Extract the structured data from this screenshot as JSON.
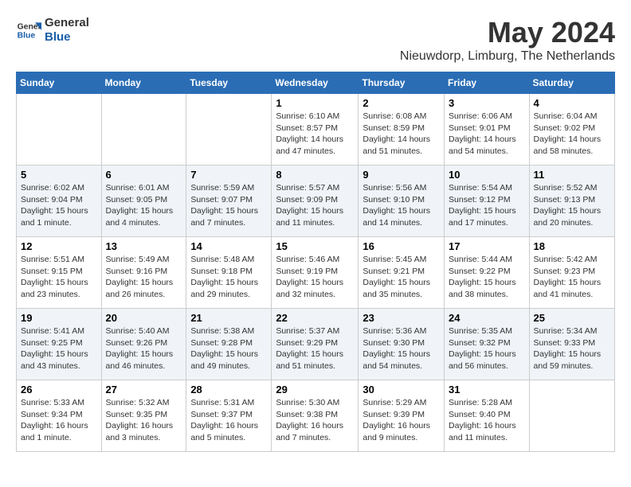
{
  "logo": {
    "general": "General",
    "blue": "Blue"
  },
  "title": "May 2024",
  "location": "Nieuwdorp, Limburg, The Netherlands",
  "days_header": [
    "Sunday",
    "Monday",
    "Tuesday",
    "Wednesday",
    "Thursday",
    "Friday",
    "Saturday"
  ],
  "weeks": [
    [
      {
        "day": "",
        "sunrise": "",
        "sunset": "",
        "daylight": ""
      },
      {
        "day": "",
        "sunrise": "",
        "sunset": "",
        "daylight": ""
      },
      {
        "day": "",
        "sunrise": "",
        "sunset": "",
        "daylight": ""
      },
      {
        "day": "1",
        "sunrise": "Sunrise: 6:10 AM",
        "sunset": "Sunset: 8:57 PM",
        "daylight": "Daylight: 14 hours and 47 minutes."
      },
      {
        "day": "2",
        "sunrise": "Sunrise: 6:08 AM",
        "sunset": "Sunset: 8:59 PM",
        "daylight": "Daylight: 14 hours and 51 minutes."
      },
      {
        "day": "3",
        "sunrise": "Sunrise: 6:06 AM",
        "sunset": "Sunset: 9:01 PM",
        "daylight": "Daylight: 14 hours and 54 minutes."
      },
      {
        "day": "4",
        "sunrise": "Sunrise: 6:04 AM",
        "sunset": "Sunset: 9:02 PM",
        "daylight": "Daylight: 14 hours and 58 minutes."
      }
    ],
    [
      {
        "day": "5",
        "sunrise": "Sunrise: 6:02 AM",
        "sunset": "Sunset: 9:04 PM",
        "daylight": "Daylight: 15 hours and 1 minute."
      },
      {
        "day": "6",
        "sunrise": "Sunrise: 6:01 AM",
        "sunset": "Sunset: 9:05 PM",
        "daylight": "Daylight: 15 hours and 4 minutes."
      },
      {
        "day": "7",
        "sunrise": "Sunrise: 5:59 AM",
        "sunset": "Sunset: 9:07 PM",
        "daylight": "Daylight: 15 hours and 7 minutes."
      },
      {
        "day": "8",
        "sunrise": "Sunrise: 5:57 AM",
        "sunset": "Sunset: 9:09 PM",
        "daylight": "Daylight: 15 hours and 11 minutes."
      },
      {
        "day": "9",
        "sunrise": "Sunrise: 5:56 AM",
        "sunset": "Sunset: 9:10 PM",
        "daylight": "Daylight: 15 hours and 14 minutes."
      },
      {
        "day": "10",
        "sunrise": "Sunrise: 5:54 AM",
        "sunset": "Sunset: 9:12 PM",
        "daylight": "Daylight: 15 hours and 17 minutes."
      },
      {
        "day": "11",
        "sunrise": "Sunrise: 5:52 AM",
        "sunset": "Sunset: 9:13 PM",
        "daylight": "Daylight: 15 hours and 20 minutes."
      }
    ],
    [
      {
        "day": "12",
        "sunrise": "Sunrise: 5:51 AM",
        "sunset": "Sunset: 9:15 PM",
        "daylight": "Daylight: 15 hours and 23 minutes."
      },
      {
        "day": "13",
        "sunrise": "Sunrise: 5:49 AM",
        "sunset": "Sunset: 9:16 PM",
        "daylight": "Daylight: 15 hours and 26 minutes."
      },
      {
        "day": "14",
        "sunrise": "Sunrise: 5:48 AM",
        "sunset": "Sunset: 9:18 PM",
        "daylight": "Daylight: 15 hours and 29 minutes."
      },
      {
        "day": "15",
        "sunrise": "Sunrise: 5:46 AM",
        "sunset": "Sunset: 9:19 PM",
        "daylight": "Daylight: 15 hours and 32 minutes."
      },
      {
        "day": "16",
        "sunrise": "Sunrise: 5:45 AM",
        "sunset": "Sunset: 9:21 PM",
        "daylight": "Daylight: 15 hours and 35 minutes."
      },
      {
        "day": "17",
        "sunrise": "Sunrise: 5:44 AM",
        "sunset": "Sunset: 9:22 PM",
        "daylight": "Daylight: 15 hours and 38 minutes."
      },
      {
        "day": "18",
        "sunrise": "Sunrise: 5:42 AM",
        "sunset": "Sunset: 9:23 PM",
        "daylight": "Daylight: 15 hours and 41 minutes."
      }
    ],
    [
      {
        "day": "19",
        "sunrise": "Sunrise: 5:41 AM",
        "sunset": "Sunset: 9:25 PM",
        "daylight": "Daylight: 15 hours and 43 minutes."
      },
      {
        "day": "20",
        "sunrise": "Sunrise: 5:40 AM",
        "sunset": "Sunset: 9:26 PM",
        "daylight": "Daylight: 15 hours and 46 minutes."
      },
      {
        "day": "21",
        "sunrise": "Sunrise: 5:38 AM",
        "sunset": "Sunset: 9:28 PM",
        "daylight": "Daylight: 15 hours and 49 minutes."
      },
      {
        "day": "22",
        "sunrise": "Sunrise: 5:37 AM",
        "sunset": "Sunset: 9:29 PM",
        "daylight": "Daylight: 15 hours and 51 minutes."
      },
      {
        "day": "23",
        "sunrise": "Sunrise: 5:36 AM",
        "sunset": "Sunset: 9:30 PM",
        "daylight": "Daylight: 15 hours and 54 minutes."
      },
      {
        "day": "24",
        "sunrise": "Sunrise: 5:35 AM",
        "sunset": "Sunset: 9:32 PM",
        "daylight": "Daylight: 15 hours and 56 minutes."
      },
      {
        "day": "25",
        "sunrise": "Sunrise: 5:34 AM",
        "sunset": "Sunset: 9:33 PM",
        "daylight": "Daylight: 15 hours and 59 minutes."
      }
    ],
    [
      {
        "day": "26",
        "sunrise": "Sunrise: 5:33 AM",
        "sunset": "Sunset: 9:34 PM",
        "daylight": "Daylight: 16 hours and 1 minute."
      },
      {
        "day": "27",
        "sunrise": "Sunrise: 5:32 AM",
        "sunset": "Sunset: 9:35 PM",
        "daylight": "Daylight: 16 hours and 3 minutes."
      },
      {
        "day": "28",
        "sunrise": "Sunrise: 5:31 AM",
        "sunset": "Sunset: 9:37 PM",
        "daylight": "Daylight: 16 hours and 5 minutes."
      },
      {
        "day": "29",
        "sunrise": "Sunrise: 5:30 AM",
        "sunset": "Sunset: 9:38 PM",
        "daylight": "Daylight: 16 hours and 7 minutes."
      },
      {
        "day": "30",
        "sunrise": "Sunrise: 5:29 AM",
        "sunset": "Sunset: 9:39 PM",
        "daylight": "Daylight: 16 hours and 9 minutes."
      },
      {
        "day": "31",
        "sunrise": "Sunrise: 5:28 AM",
        "sunset": "Sunset: 9:40 PM",
        "daylight": "Daylight: 16 hours and 11 minutes."
      },
      {
        "day": "",
        "sunrise": "",
        "sunset": "",
        "daylight": ""
      }
    ]
  ]
}
